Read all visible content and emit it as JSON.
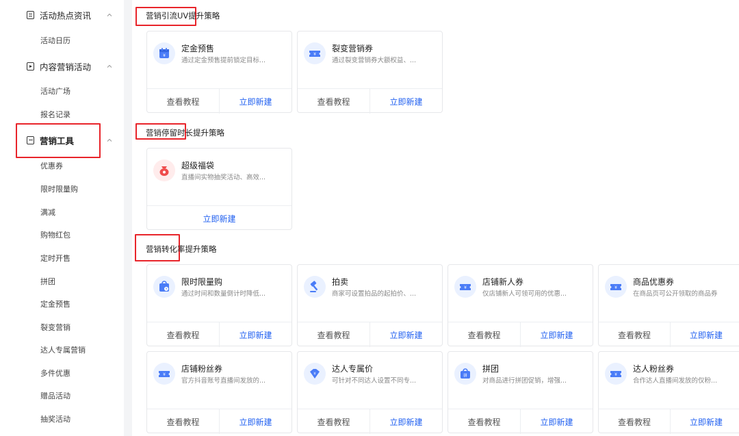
{
  "sidebar": {
    "groups": [
      {
        "label": "活动热点资讯",
        "icon": "document-icon",
        "items": [
          "活动日历"
        ]
      },
      {
        "label": "内容营销活动",
        "icon": "play-icon",
        "items": [
          "活动广场",
          "报名记录"
        ]
      },
      {
        "label": "营销工具",
        "icon": "toolbox-icon",
        "items": [
          "优惠券",
          "限时限量购",
          "满减",
          "购物红包",
          "定时开售",
          "拼团",
          "定金预售",
          "裂变营销",
          "达人专属营销",
          "多件优惠",
          "赠品活动",
          "抽奖活动"
        ]
      }
    ]
  },
  "sections": [
    {
      "title": "营销引流UV提升策略",
      "cards": [
        {
          "title": "定金预售",
          "desc": "通过定金预售提前锁定目标...",
          "icon": "calendar-icon",
          "tutorial": "查看教程",
          "create": "立即新建"
        },
        {
          "title": "裂变营销券",
          "desc": "通过裂变营销券大额权益、...",
          "icon": "coupon-icon",
          "tutorial": "查看教程",
          "create": "立即新建"
        }
      ]
    },
    {
      "title": "营销停留时长提升策略",
      "cards": [
        {
          "title": "超级福袋",
          "desc": "直播间实物抽奖活动、高效...",
          "icon": "lucky-bag-icon",
          "create": "立即新建"
        }
      ]
    },
    {
      "title": "营销转化率提升策略",
      "cards": [
        {
          "title": "限时限量购",
          "desc": "通过时间和数量倒计时降低...",
          "icon": "timer-bag-icon",
          "tutorial": "查看教程",
          "create": "立即新建"
        },
        {
          "title": "拍卖",
          "desc": "商家可设置拍品的起拍价、...",
          "icon": "gavel-icon",
          "tutorial": "查看教程",
          "create": "立即新建"
        },
        {
          "title": "店铺新人券",
          "desc": "仅店铺新人可领可用的优惠...",
          "icon": "coupon-icon",
          "tutorial": "查看教程",
          "create": "立即新建"
        },
        {
          "title": "商品优惠券",
          "desc": "在商品页可公开领取的商品券",
          "icon": "coupon-icon",
          "tutorial": "查看教程",
          "create": "立即新建"
        },
        {
          "title": "店铺粉丝券",
          "desc": "官方抖音账号直播间发放的...",
          "icon": "coupon-icon",
          "tutorial": "查看教程",
          "create": "立即新建"
        },
        {
          "title": "达人专属价",
          "desc": "可针对不同达人设置不同专...",
          "icon": "tag-icon",
          "tutorial": "查看教程",
          "create": "立即新建"
        },
        {
          "title": "拼团",
          "desc": "对商品进行拼团促销，增强...",
          "icon": "group-buy-icon",
          "tutorial": "查看教程",
          "create": "立即新建"
        },
        {
          "title": "达人粉丝券",
          "desc": "合作达人直播间发放的仅粉...",
          "icon": "coupon-icon",
          "tutorial": "查看教程",
          "create": "立即新建"
        }
      ]
    }
  ],
  "colors": {
    "accent": "#1f5ff0",
    "annotation_red": "#e8242a",
    "icon_blue": "#4a7cf7",
    "icon_red": "#ef4d4d"
  }
}
